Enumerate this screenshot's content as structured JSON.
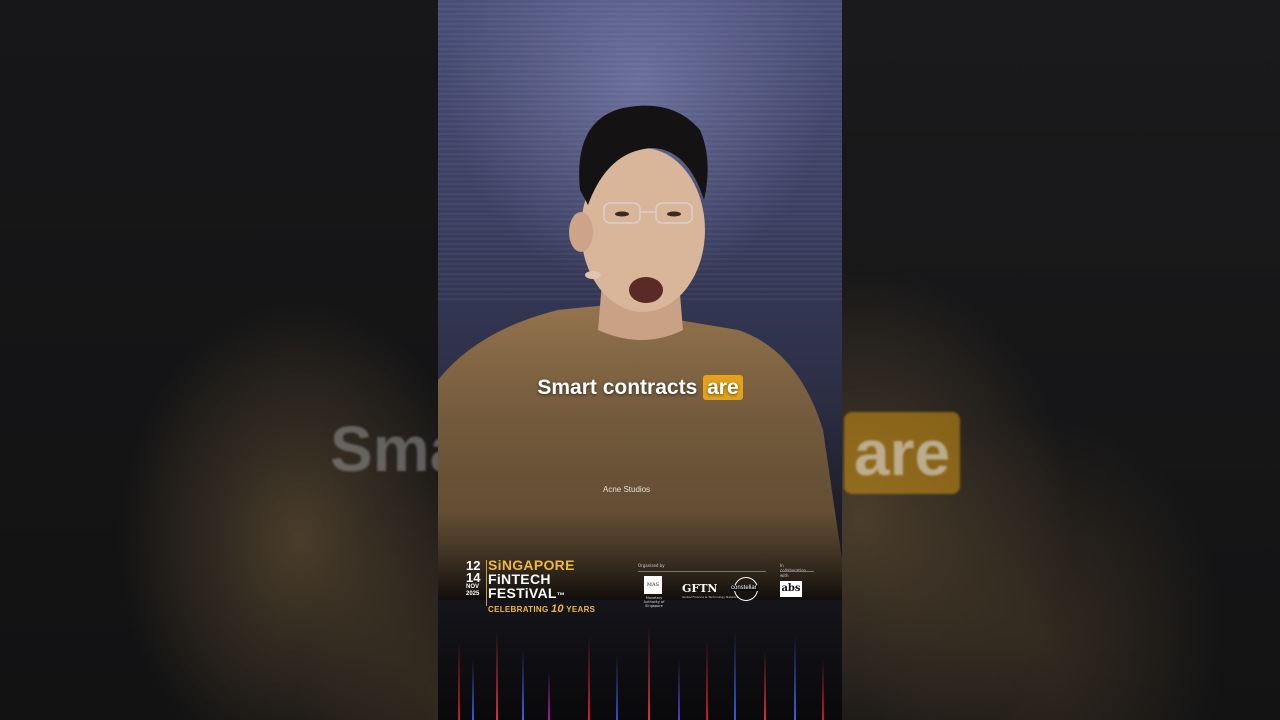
{
  "caption": {
    "before": "Smart contracts ",
    "highlight": "are"
  },
  "background_echo": {
    "left_word": "Sma",
    "right_word": "are"
  },
  "shirt_text": "Acne Studios",
  "festival": {
    "date_top": "12",
    "date_bottom": "14",
    "month": "NOV",
    "year": "2025",
    "line1": "SiNGAPORE",
    "line2": "FiNTECH",
    "line3": "FESTiVAL",
    "trademark": "™",
    "tagline_pre": "CELEBRATING ",
    "tagline_num": "10",
    "tagline_post": " YEARS"
  },
  "organizers": {
    "organized_by": "Organised by",
    "collab": "In collaboration with",
    "mas": "MAS",
    "mas_sub": "Monetary Authority of Singapore",
    "gftn": "GFTN",
    "gftn_sub": "Global Finance & Technology Network",
    "constellar": "constellar",
    "abs": "abs"
  },
  "colors": {
    "highlight": "#e3a21a",
    "festival_gold": "#f0b83a"
  }
}
